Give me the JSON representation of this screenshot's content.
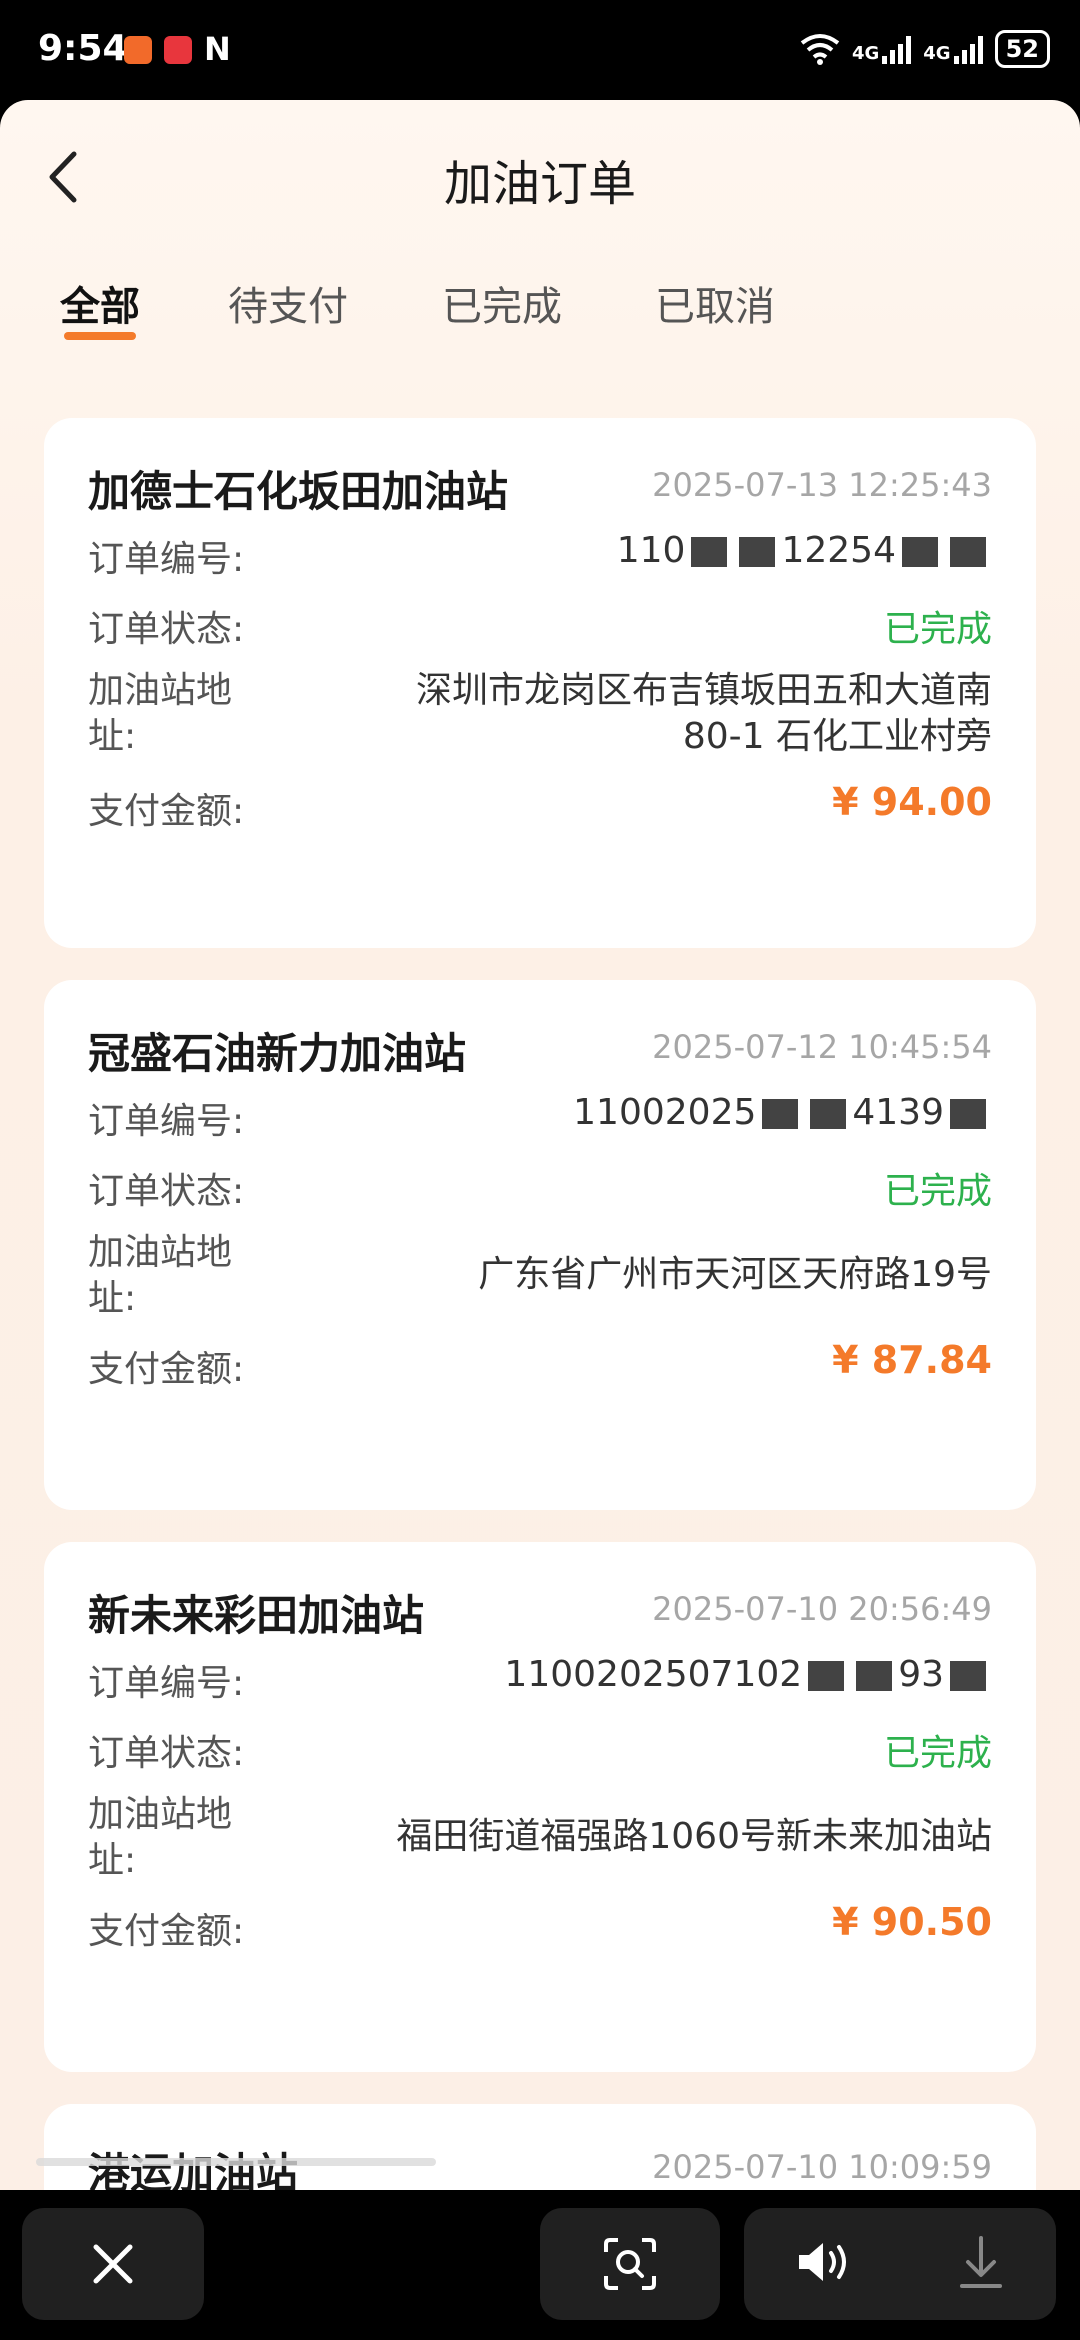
{
  "status_bar": {
    "time": "9:54",
    "nfc": "N",
    "network1": "4G",
    "network2": "4G",
    "battery": "52"
  },
  "header": {
    "title": "加油订单",
    "back_icon": "chevron-left-icon"
  },
  "tabs": [
    {
      "label": "全部",
      "active": true
    },
    {
      "label": "待支付",
      "active": false
    },
    {
      "label": "已完成",
      "active": false
    },
    {
      "label": "已取消",
      "active": false
    }
  ],
  "labels": {
    "order_no": "订单编号:",
    "order_status": "订单状态:",
    "station_address_line1": "加油站地",
    "station_address_line2": "址:",
    "pay_amount": "支付金额:"
  },
  "orders": [
    {
      "station": "加德士石化坂田加油站",
      "time": "2025-07-13 12:25:43",
      "order_no_prefix": "110",
      "order_no_mid": "12254",
      "status": "已完成",
      "address_line1": "深圳市龙岗区布吉镇坂田五和大道南",
      "address_line2": "80-1 石化工业村旁",
      "amount": "¥ 94.00"
    },
    {
      "station": "冠盛石油新力加油站",
      "time": "2025-07-12 10:45:54",
      "order_no_prefix": "11002025",
      "order_no_mid": "4139",
      "status": "已完成",
      "address_line1": "广东省广州市天河区天府路19号",
      "amount": "¥ 87.84"
    },
    {
      "station": "新未来彩田加油站",
      "time": "2025-07-10 20:56:49",
      "order_no_prefix": "1100202507102",
      "order_no_mid": "93",
      "status": "已完成",
      "address_line1": "福田街道福强路1060号新未来加油站",
      "amount": "¥ 90.50"
    },
    {
      "station": "港运加油站",
      "time": "2025-07-10 10:09:59"
    }
  ],
  "colors": {
    "accent": "#f47a2a",
    "status_done": "#2db14d"
  }
}
